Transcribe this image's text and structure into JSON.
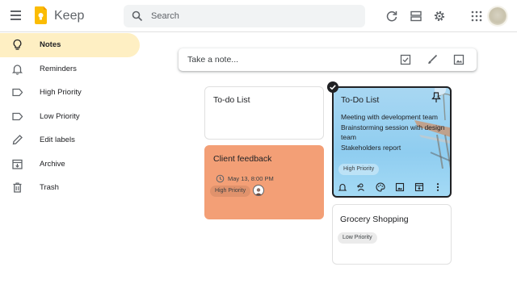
{
  "app": {
    "name": "Keep"
  },
  "search": {
    "placeholder": "Search"
  },
  "sidebar": {
    "items": [
      {
        "label": "Notes",
        "icon": "lightbulb-icon",
        "active": true
      },
      {
        "label": "Reminders",
        "icon": "bell-icon"
      },
      {
        "label": "High Priority",
        "icon": "label-icon"
      },
      {
        "label": "Low Priority",
        "icon": "label-icon"
      },
      {
        "label": "Edit labels",
        "icon": "pencil-icon"
      },
      {
        "label": "Archive",
        "icon": "archive-icon"
      },
      {
        "label": "Trash",
        "icon": "trash-icon"
      }
    ]
  },
  "take_note": {
    "placeholder": "Take a note..."
  },
  "notes": [
    {
      "title": "To-do List"
    },
    {
      "title": "Client feedback",
      "reminder": "May 13, 8:00 PM",
      "label": "High Priority",
      "color": "#f39f76"
    },
    {
      "title": "To-Do List",
      "body": [
        "Meeting with development team",
        "Brainstorming session with design team",
        "Stakeholders report"
      ],
      "label": "High Priority"
    },
    {
      "title": "Grocery Shopping",
      "label": "Low Priority"
    }
  ],
  "colors": {
    "accent": "#feefc3",
    "logo": "#fbbc04"
  }
}
